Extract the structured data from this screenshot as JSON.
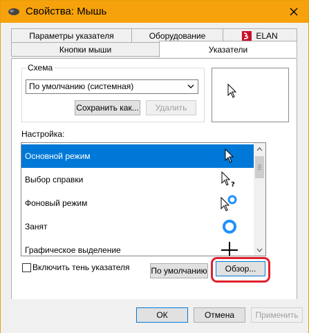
{
  "window": {
    "title": "Свойства: Мышь",
    "accent_color": "#f6a20c"
  },
  "tabs": {
    "row1": [
      "Параметры указателя",
      "Оборудование",
      "ELAN"
    ],
    "row2": [
      "Кнопки мыши",
      "Указатели"
    ],
    "active": "Указатели"
  },
  "scheme": {
    "group_label": "Схема",
    "selected": "По умолчанию (системная)",
    "save_label": "Сохранить как...",
    "delete_label": "Удалить"
  },
  "settings": {
    "label": "Настройка:",
    "items": [
      {
        "label": "Основной режим",
        "cursor": "arrow-icon"
      },
      {
        "label": "Выбор справки",
        "cursor": "help-select-icon"
      },
      {
        "label": "Фоновый режим",
        "cursor": "working-in-background-icon"
      },
      {
        "label": "Занят",
        "cursor": "busy-icon"
      },
      {
        "label": "Графическое выделение",
        "cursor": "precision-select-icon"
      }
    ],
    "selected_index": 0
  },
  "shadow": {
    "label": "Включить тень указателя",
    "checked": false
  },
  "actions": {
    "default_label": "По умолчанию",
    "browse_label": "Обзор..."
  },
  "footer": {
    "ok_label": "ОК",
    "cancel_label": "Отмена",
    "apply_label": "Применить"
  },
  "colors": {
    "selection": "#0078d7",
    "highlight_ring": "#e0202a"
  }
}
